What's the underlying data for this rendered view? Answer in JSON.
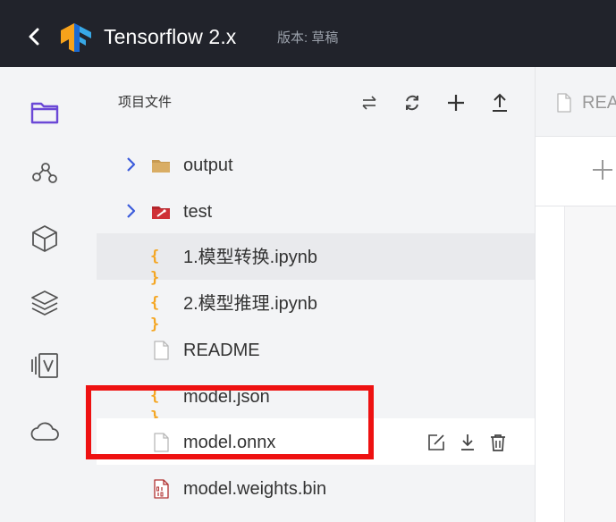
{
  "header": {
    "back_icon": "chevron-left-icon",
    "logo_icon": "tensorflow-logo-icon",
    "app_title": "Tensorflow 2.x",
    "version_label": "版本: 草稿"
  },
  "rail": {
    "icons": [
      "folder-icon",
      "graph-nodes-icon",
      "cube-icon",
      "layers-icon",
      "versions-icon",
      "cloud-icon"
    ]
  },
  "file_panel": {
    "title": "项目文件",
    "toolbar_icons": [
      "swap-icon",
      "refresh-icon",
      "plus-icon",
      "upload-icon"
    ],
    "items": [
      {
        "name": "output",
        "kind": "folder",
        "expandable": true,
        "icon": "folder-icon"
      },
      {
        "name": "test",
        "kind": "folder",
        "expandable": true,
        "icon": "folder-icon"
      },
      {
        "name": "1.模型转换.ipynb",
        "kind": "notebook",
        "icon": "braces-icon",
        "selected": true
      },
      {
        "name": "2.模型推理.ipynb",
        "kind": "notebook",
        "icon": "braces-icon"
      },
      {
        "name": "README",
        "kind": "file",
        "icon": "file-icon"
      },
      {
        "name": "model.json",
        "kind": "json",
        "icon": "braces-icon"
      },
      {
        "name": "model.onnx",
        "kind": "file",
        "icon": "file-icon",
        "hovered": true,
        "row_actions": [
          "edit-icon",
          "download-icon",
          "trash-icon"
        ]
      },
      {
        "name": "model.weights.bin",
        "kind": "binary",
        "icon": "binary-file-icon"
      }
    ],
    "braces_glyph": "{ }"
  },
  "editor": {
    "tab_label": "REA"
  },
  "colors": {
    "header_bg": "#21232b",
    "panel_bg": "#f3f4f6",
    "accent": "#6b48d6",
    "highlight": "#ee1111",
    "brace": "#f4a623",
    "chevron": "#3b5bdb"
  }
}
